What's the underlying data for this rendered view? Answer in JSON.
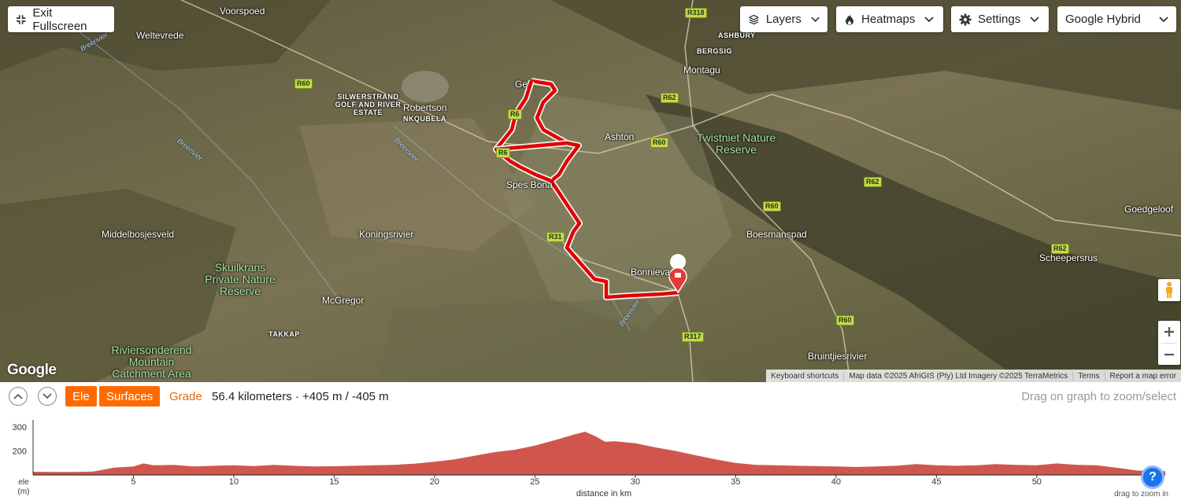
{
  "map": {
    "buttons": {
      "exit_fullscreen": "Exit Fullscreen",
      "layers": "Layers",
      "heatmaps": "Heatmaps",
      "settings": "Settings",
      "map_type": "Google Hybrid"
    },
    "places": {
      "voorspoed": "Voorspoed",
      "weltevrede": "Weltevrede",
      "silwerstrand": "SILWERSTRAND GOLF AND RIVER ESTATE",
      "robertson": "Robertson",
      "nkqubela": "NKQUBELA",
      "ashbury": "ASHBURY",
      "bergsig": "BERGSIG",
      "montagu": "Montagu",
      "ashton": "Ashton",
      "twistniet": "Twistniet Nature Reserve",
      "spes_bona": "Spes Bona",
      "ge": "Ge",
      "goedgeloof": "Goedgeloof",
      "middelbosjesveld": "Middelbosjesveld",
      "koningsrivier": "Koningsrivier",
      "boesmanspad": "Boesmanspad",
      "scheepersrus": "Scheepersrus",
      "skuilkrans": "Skuilkrans Private Nature Reserve",
      "mcgregor": "McGregor",
      "bonnievale": "Bonnieva",
      "takkap": "TAKKAP",
      "riviersonderend": "Riviersonderend Mountain Catchment Area",
      "bruintjiesrivier": "Bruintjiesrivier"
    },
    "rivers": {
      "breerivier": "Breerivier"
    },
    "roads": [
      "R318",
      "R60",
      "R62",
      "R60",
      "R60",
      "R62",
      "R60",
      "R62",
      "R317",
      "R60",
      "R31",
      "R6",
      "R6"
    ],
    "google_logo": "Google",
    "attribution": {
      "keyboard": "Keyboard shortcuts",
      "data": "Map data ©2025 AfriGIS (Pty) Ltd Imagery ©2025 TerraMetrics",
      "terms": "Terms",
      "report": "Report a map error"
    },
    "route_color": "#e00000"
  },
  "profile": {
    "tabs": {
      "ele": "Ele",
      "surfaces": "Surfaces",
      "grade": "Grade"
    },
    "active_tab": "Ele",
    "accent": "#ff6a00",
    "stats": "56.4 kilometers · +405 m / -405 m",
    "drag_hint": "Drag on graph to zoom/select",
    "drag_zoom": "drag to zoom in"
  },
  "chart_data": {
    "type": "area",
    "xlabel": "distance in km",
    "ylabel": "ele (m)",
    "ylabel_line1": "ele",
    "ylabel_line2": "(m)",
    "xlim": [
      0,
      56.4
    ],
    "ylim": [
      100,
      310
    ],
    "y_ticks": [
      200,
      300
    ],
    "x_ticks": [
      5,
      10,
      15,
      20,
      25,
      30,
      35,
      40,
      45,
      50
    ],
    "fill_color": "#d0564d",
    "x": [
      0,
      1,
      2,
      3,
      4,
      5,
      5.5,
      6,
      7,
      8,
      9,
      10,
      11,
      12,
      13,
      14,
      15,
      16,
      17,
      18,
      19,
      20,
      21,
      22,
      23,
      24,
      25,
      26,
      27,
      27.5,
      28,
      28.5,
      29,
      30,
      31,
      32,
      33,
      34,
      35,
      36,
      37,
      38,
      39,
      40,
      41,
      42,
      43,
      44,
      45,
      46,
      47,
      48,
      49,
      50,
      51,
      52,
      53,
      54,
      55,
      56.4
    ],
    "values": [
      113,
      112,
      112,
      114,
      130,
      135,
      148,
      140,
      142,
      135,
      138,
      140,
      137,
      142,
      138,
      135,
      136,
      138,
      140,
      142,
      147,
      155,
      165,
      180,
      195,
      205,
      222,
      245,
      270,
      280,
      262,
      238,
      240,
      232,
      215,
      200,
      182,
      165,
      150,
      142,
      140,
      138,
      137,
      135,
      133,
      135,
      138,
      145,
      140,
      138,
      140,
      145,
      142,
      140,
      148,
      142,
      140,
      130,
      118,
      115
    ]
  }
}
